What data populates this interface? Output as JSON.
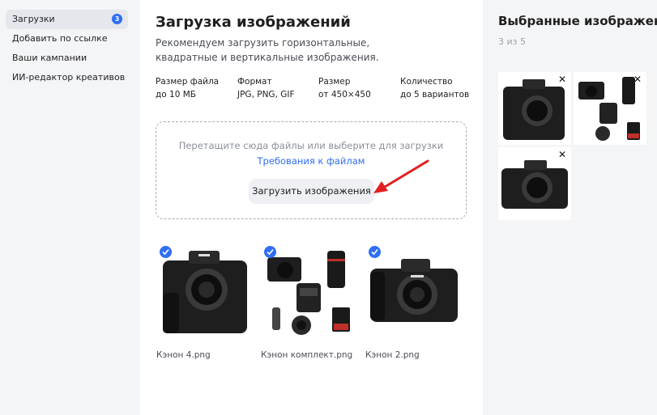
{
  "sidebar": {
    "items": [
      {
        "label": "Загрузки",
        "badge": "3",
        "active": true
      },
      {
        "label": "Добавить по ссылке"
      },
      {
        "label": "Ваши кампании"
      },
      {
        "label": "ИИ-редактор креативов"
      }
    ]
  },
  "main": {
    "title": "Загрузка изображений",
    "description": "Рекомендуем загрузить горизонтальные, квадратные и вертикальные изображения.",
    "specs": [
      {
        "label": "Размер файла",
        "value": "до 10 МБ"
      },
      {
        "label": "Формат",
        "value": "JPG, PNG, GIF"
      },
      {
        "label": "Размер",
        "value": "от 450×450"
      },
      {
        "label": "Количество",
        "value": "до 5 вариантов"
      }
    ],
    "dropzone": {
      "hint": "Перетащите сюда файлы или выберите для загрузки",
      "requirements_link": "Требования к файлам",
      "upload_button": "Загрузить изображения"
    },
    "uploads": [
      {
        "name": "Кэнон 4.png",
        "selected": true,
        "icon": "camera-body-icon"
      },
      {
        "name": "Кэнон комплект.png",
        "selected": true,
        "icon": "camera-kit-icon"
      },
      {
        "name": "Кэнон 2.png",
        "selected": true,
        "icon": "camera-body-icon"
      }
    ]
  },
  "selected_panel": {
    "title": "Выбранные изображения",
    "count": "3 из 5",
    "close_icon": "close-icon"
  },
  "colors": {
    "accent": "#2f6ef5",
    "panel_bg": "#f4f5f7",
    "arrow": "#e0201f"
  }
}
